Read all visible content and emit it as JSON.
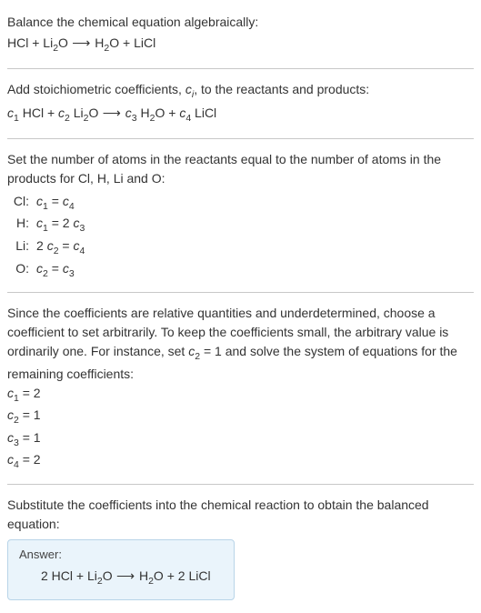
{
  "s1": {
    "title": "Balance the chemical equation algebraically:",
    "eq_pre": "HCl + Li",
    "eq_sub1": "2",
    "eq_mid1": "O",
    "arrow": "  ⟶  ",
    "eq_mid2": "H",
    "eq_sub2": "2",
    "eq_post": "O + LiCl"
  },
  "s2": {
    "title_pre": "Add stoichiometric coefficients, ",
    "ci_c": "c",
    "ci_i": "i",
    "title_post": ", to the reactants and products:",
    "c1": "c",
    "n1": "1",
    "t1": " HCl + ",
    "c2": "c",
    "n2": "2",
    "t2": " Li",
    "sub_li2": "2",
    "t3": "O",
    "arrow": "  ⟶  ",
    "c3": "c",
    "n3": "3",
    "t4": " H",
    "sub_h2": "2",
    "t5": "O + ",
    "c4": "c",
    "n4": "4",
    "t6": " LiCl"
  },
  "s3": {
    "title": "Set the number of atoms in the reactants equal to the number of atoms in the products for Cl, H, Li and O:",
    "rows": [
      {
        "label": "Cl:",
        "c_a": "c",
        "n_a": "1",
        "mid": " = ",
        "c_b": "c",
        "n_b": "4",
        "extra": ""
      },
      {
        "label": "H:",
        "c_a": "c",
        "n_a": "1",
        "mid": " = 2 ",
        "c_b": "c",
        "n_b": "3",
        "extra": ""
      },
      {
        "label": "Li:",
        "pre": "2 ",
        "c_a": "c",
        "n_a": "2",
        "mid": " = ",
        "c_b": "c",
        "n_b": "4",
        "extra": ""
      },
      {
        "label": "O:",
        "c_a": "c",
        "n_a": "2",
        "mid": " = ",
        "c_b": "c",
        "n_b": "3",
        "extra": ""
      }
    ]
  },
  "s4": {
    "p_pre": "Since the coefficients are relative quantities and underdetermined, choose a coefficient to set arbitrarily. To keep the coefficients small, the arbitrary value is ordinarily one. For instance, set ",
    "set_c": "c",
    "set_n": "2",
    "set_eq": " = 1",
    "p_post": " and solve the system of equations for the remaining coefficients:",
    "coefs": [
      {
        "c": "c",
        "n": "1",
        "eq": " = 2"
      },
      {
        "c": "c",
        "n": "2",
        "eq": " = 1"
      },
      {
        "c": "c",
        "n": "3",
        "eq": " = 1"
      },
      {
        "c": "c",
        "n": "4",
        "eq": " = 2"
      }
    ]
  },
  "s5": {
    "title": "Substitute the coefficients into the chemical reaction to obtain the balanced equation:",
    "answer_label": "Answer:",
    "eq_a": "2 HCl + Li",
    "sub1": "2",
    "eq_b": "O",
    "arrow": "  ⟶  ",
    "eq_c": "H",
    "sub2": "2",
    "eq_d": "O + 2 LiCl"
  }
}
